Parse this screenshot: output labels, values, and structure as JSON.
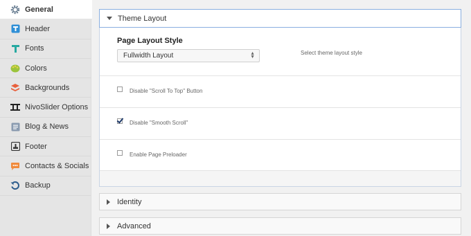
{
  "sidebar": {
    "items": [
      {
        "label": "General",
        "icon": "gear-icon",
        "active": true
      },
      {
        "label": "Header",
        "icon": "header-icon"
      },
      {
        "label": "Fonts",
        "icon": "font-icon"
      },
      {
        "label": "Colors",
        "icon": "color-palette-icon"
      },
      {
        "label": "Backgrounds",
        "icon": "layers-icon"
      },
      {
        "label": "NivoSlider Options",
        "icon": "slider-icon"
      },
      {
        "label": "Blog & News",
        "icon": "document-icon"
      },
      {
        "label": "Footer",
        "icon": "footer-icon"
      },
      {
        "label": "Contacts & Socials",
        "icon": "chat-icon"
      },
      {
        "label": "Backup",
        "icon": "backup-icon"
      }
    ]
  },
  "main": {
    "theme_layout": {
      "title": "Theme Layout",
      "page_layout_title": "Page Layout Style",
      "select_value": "Fullwidth Layout",
      "select_hint": "Select theme layout style",
      "options": [
        {
          "label": "Disable \"Scroll To Top\" Button",
          "checked": false
        },
        {
          "label": "Disable \"Smooth Scroll\"",
          "checked": true
        },
        {
          "label": "Enable Page Preloader",
          "checked": false
        }
      ]
    },
    "identity": {
      "title": "Identity"
    },
    "advanced": {
      "title": "Advanced"
    }
  }
}
